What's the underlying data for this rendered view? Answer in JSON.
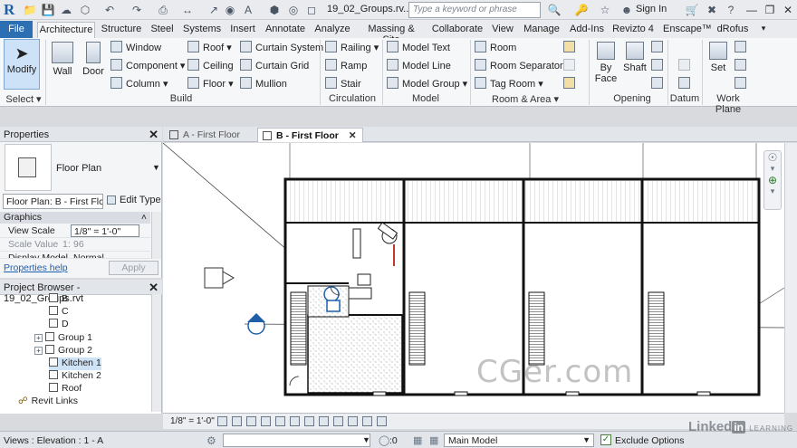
{
  "titlebar": {
    "document_title": "19_02_Groups.rv...",
    "search_placeholder": "Type a keyword or phrase",
    "sign_in": "Sign In"
  },
  "ribbon_tabs": [
    "File",
    "Architecture",
    "Structure",
    "Steel",
    "Systems",
    "Insert",
    "Annotate",
    "Analyze",
    "Massing & Site",
    "Collaborate",
    "View",
    "Manage",
    "Add-Ins",
    "Revizto 4",
    "Enscape™",
    "dRofus"
  ],
  "ribbon": {
    "select": {
      "modify": "Modify",
      "label": "Select ▾"
    },
    "build": {
      "label": "Build",
      "wall": "Wall",
      "door": "Door",
      "window": "Window",
      "component": "Component",
      "column": "Column",
      "roof": "Roof",
      "ceiling": "Ceiling",
      "floor": "Floor",
      "curtain_system": "Curtain System",
      "curtain_grid": "Curtain Grid",
      "mullion": "Mullion"
    },
    "circulation": {
      "label": "Circulation",
      "railing": "Railing",
      "ramp": "Ramp",
      "stair": "Stair"
    },
    "model": {
      "label": "Model",
      "model_text": "Model Text",
      "model_line": "Model Line",
      "model_group": "Model Group"
    },
    "room_area": {
      "label": "Room & Area ▾",
      "room": "Room",
      "room_separator": "Room Separator",
      "tag_room": "Tag Room"
    },
    "opening": {
      "label": "Opening",
      "by_face": "By Face",
      "shaft": "Shaft"
    },
    "datum": {
      "label": "Datum"
    },
    "work_plane": {
      "label": "Work Plane",
      "set": "Set"
    }
  },
  "properties": {
    "title": "Properties",
    "type_name": "Floor Plan",
    "instance_selector": "Floor Plan: B - First Flc",
    "edit_type": "Edit Type",
    "section": "Graphics",
    "rows": [
      {
        "key": "View Scale",
        "value": "1/8\" = 1'-0\""
      },
      {
        "key": "Scale Value",
        "prefix": "1:",
        "value": "96"
      },
      {
        "key": "Display Model",
        "value": "Normal"
      }
    ],
    "help_link": "Properties help",
    "apply": "Apply"
  },
  "project_browser": {
    "title": "Project Browser - 19_02_Groups.rvt",
    "items": [
      {
        "label": "B",
        "expand": false
      },
      {
        "label": "C",
        "expand": false
      },
      {
        "label": "D",
        "expand": false
      },
      {
        "label": "Group 1",
        "expand": true
      },
      {
        "label": "Group 2",
        "expand": true
      },
      {
        "label": "Kitchen 1",
        "expand": false,
        "selected": true
      },
      {
        "label": "Kitchen 2",
        "expand": false
      },
      {
        "label": "Roof",
        "expand": false
      }
    ],
    "revit_links": "Revit Links"
  },
  "view_tabs": [
    {
      "label": "A - First Floor",
      "active": false
    },
    {
      "label": "B - First Floor",
      "active": true
    }
  ],
  "view_bar": {
    "scale": "1/8\" = 1'-0\""
  },
  "status": {
    "text": "Views : Elevation : 1 - A",
    "coord": ":0",
    "workset": "Main Model",
    "exclude_options": "Exclude Options"
  },
  "watermarks": {
    "cg": "CGer.com",
    "linkedin": "Linked",
    "linkedin_in": "in",
    "learning": "LEARNING"
  }
}
